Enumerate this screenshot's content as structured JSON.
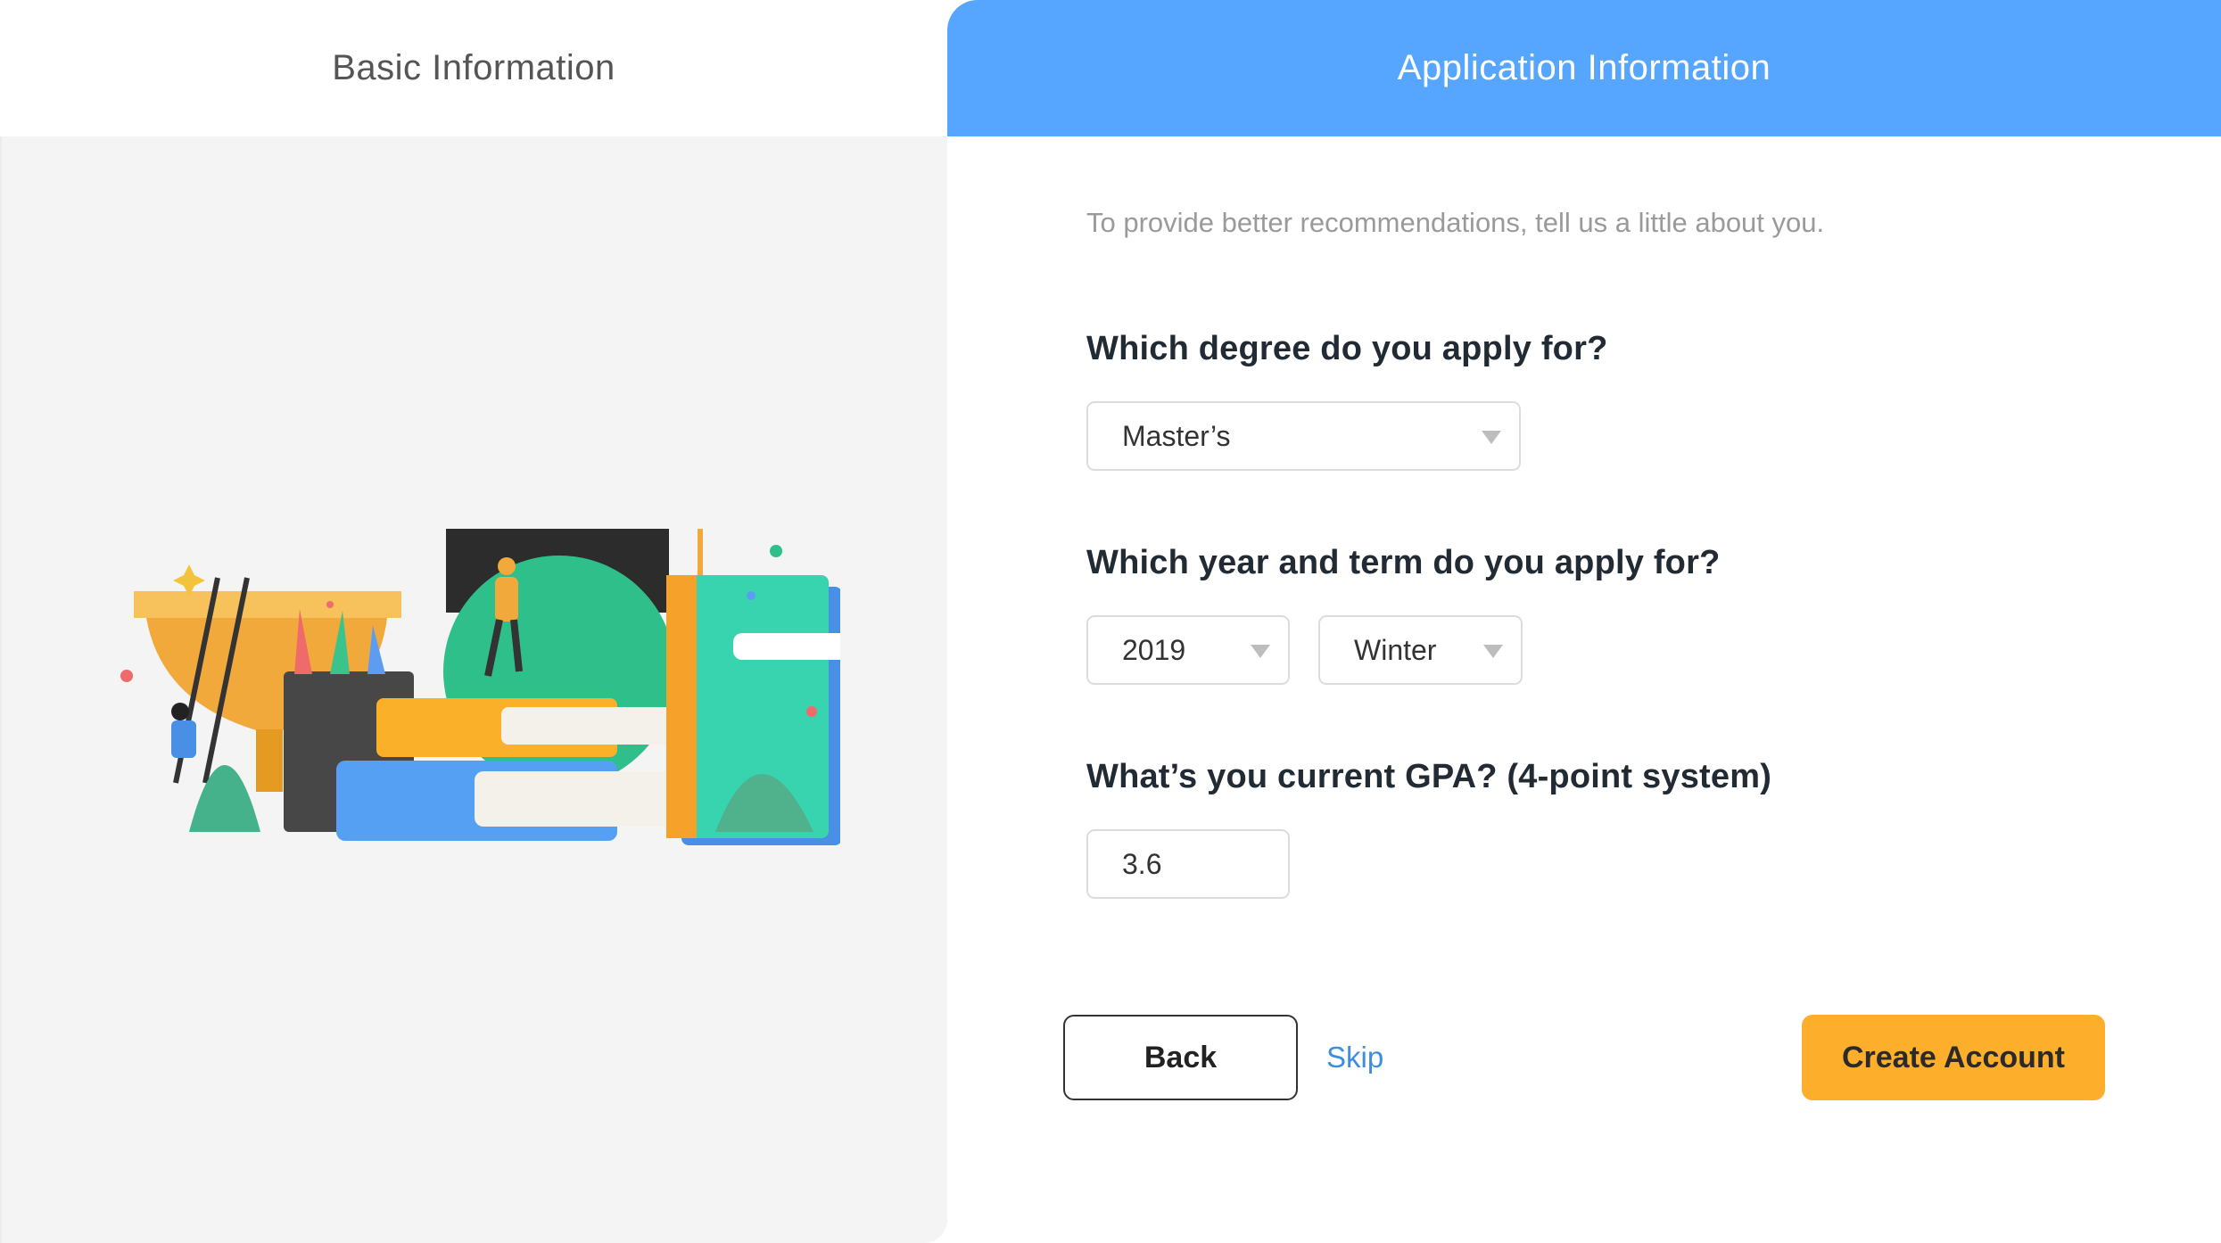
{
  "tabs": {
    "basic": "Basic Information",
    "application": "Application Information"
  },
  "form": {
    "intro": "To provide better recommendations, tell us a little about you.",
    "degree": {
      "question": "Which degree do you apply for?",
      "value": "Master’s"
    },
    "term": {
      "question": "Which year and term do you apply for?",
      "year": "2019",
      "term": "Winter"
    },
    "gpa": {
      "question": "What’s you current GPA? (4-point system)",
      "value": "3.6"
    }
  },
  "actions": {
    "back": "Back",
    "skip": "Skip",
    "create": "Create Account"
  },
  "colors": {
    "accent": "#56a6ff",
    "primary_button": "#fdaf2c",
    "link": "#3d8de0"
  }
}
